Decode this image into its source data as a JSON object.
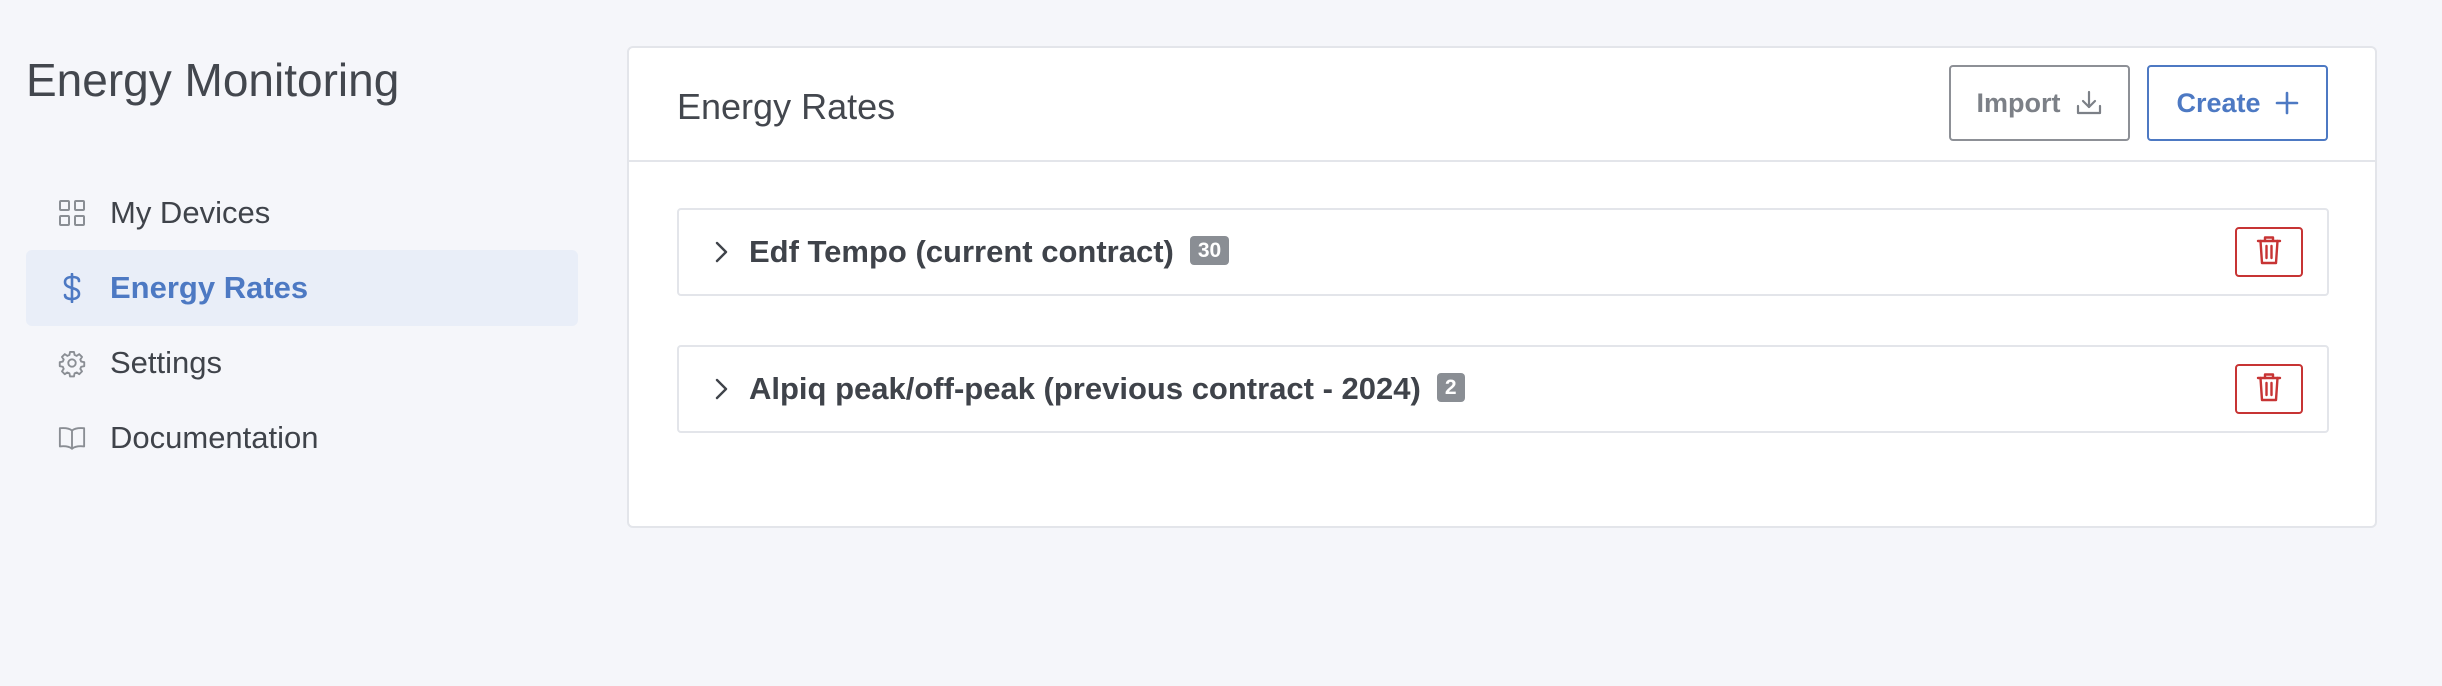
{
  "app": {
    "title": "Energy Monitoring"
  },
  "sidebar": {
    "items": [
      {
        "label": "My Devices",
        "icon": "grid-icon",
        "active": false
      },
      {
        "label": "Energy Rates",
        "icon": "dollar-icon",
        "active": true
      },
      {
        "label": "Settings",
        "icon": "gear-icon",
        "active": false
      },
      {
        "label": "Documentation",
        "icon": "book-icon",
        "active": false
      }
    ]
  },
  "main": {
    "title": "Energy Rates",
    "import_label": "Import",
    "create_label": "Create",
    "rates": [
      {
        "name": "Edf Tempo (current contract)",
        "count": "30"
      },
      {
        "name": "Alpiq peak/off-peak (previous contract - 2024)",
        "count": "2"
      }
    ]
  },
  "colors": {
    "accent": "#4d79c3",
    "danger": "#c73434",
    "active_bg": "#e9eef8",
    "page_bg": "#f5f6fa"
  }
}
